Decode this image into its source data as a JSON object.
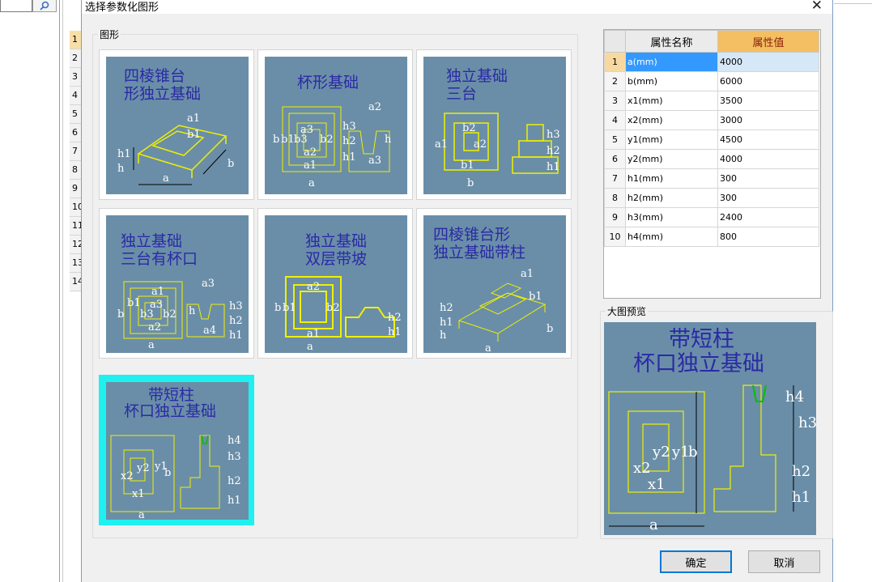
{
  "dialog": {
    "title": "选择参数化图形",
    "close_icon": "close-icon",
    "shape_group_label": "图形",
    "preview_group_label": "大图预览",
    "ok_label": "确定",
    "cancel_label": "取消"
  },
  "background": {
    "row_numbers": [
      "1",
      "2",
      "3",
      "4",
      "5",
      "6",
      "7",
      "8",
      "9",
      "10",
      "11",
      "12",
      "13",
      "14"
    ],
    "search_icon": "search-icon"
  },
  "shapes": [
    {
      "title1": "四棱锥台",
      "title2": "形独立基础",
      "labels": [
        "a1",
        "b1",
        "h1",
        "h",
        "a",
        "b"
      ]
    },
    {
      "title1": "杯形基础",
      "title2": "",
      "labels": [
        "b",
        "b1",
        "b3",
        "a3",
        "b2",
        "a2",
        "a1",
        "a",
        "h3",
        "h2",
        "h1",
        "h",
        "a2",
        "a3"
      ]
    },
    {
      "title1": "独立基础",
      "title2": "三台",
      "labels": [
        "a1",
        "b2",
        "a2",
        "b1",
        "b",
        "h3",
        "h2",
        "h1"
      ]
    },
    {
      "title1": "独立基础",
      "title2": "三台有杯口",
      "labels": [
        "a1",
        "b1",
        "a3",
        "b3",
        "b2",
        "a2",
        "b",
        "a",
        "a3",
        "h",
        "a4",
        "h3",
        "h2",
        "h1"
      ]
    },
    {
      "title1": "独立基础",
      "title2": "双层带坡",
      "labels": [
        "a2",
        "b1",
        "b",
        "b2",
        "a1",
        "a",
        "h2",
        "h1"
      ]
    },
    {
      "title1": "四棱锥台形",
      "title2": "独立基础带柱",
      "labels": [
        "a1",
        "b1",
        "h2",
        "h1",
        "h",
        "a",
        "b"
      ]
    },
    {
      "title1": "带短柱",
      "title2": "杯口独立基础",
      "labels": [
        "x2",
        "y2",
        "y1",
        "b",
        "x1",
        "a",
        "h4",
        "h3",
        "h2",
        "h1"
      ]
    }
  ],
  "selected_shape_index": 6,
  "properties": {
    "header_index": "",
    "header_name": "属性名称",
    "header_value": "属性值",
    "rows": [
      {
        "index": "1",
        "name": "a(mm)",
        "value": "4000"
      },
      {
        "index": "2",
        "name": "b(mm)",
        "value": "6000"
      },
      {
        "index": "3",
        "name": "x1(mm)",
        "value": "3500"
      },
      {
        "index": "4",
        "name": "x2(mm)",
        "value": "3000"
      },
      {
        "index": "5",
        "name": "y1(mm)",
        "value": "4500"
      },
      {
        "index": "6",
        "name": "y2(mm)",
        "value": "4000"
      },
      {
        "index": "7",
        "name": "h1(mm)",
        "value": "300"
      },
      {
        "index": "8",
        "name": "h2(mm)",
        "value": "300"
      },
      {
        "index": "9",
        "name": "h3(mm)",
        "value": "2400"
      },
      {
        "index": "10",
        "name": "h4(mm)",
        "value": "800"
      }
    ],
    "selected_row_index": 0
  },
  "preview": {
    "title1": "带短柱",
    "title2": "杯口独立基础",
    "labels": [
      "x2",
      "y2",
      "y1",
      "b",
      "x1",
      "a",
      "h4",
      "h3",
      "h2",
      "h1"
    ]
  },
  "colors": {
    "diagram_bg": "#6a8ea8",
    "diagram_title": "#2a2aa6",
    "diagram_lines": "#f0f000",
    "selected_thumb": "#1ff0f0",
    "header_value_bg": "#f4bf62",
    "selected_row": "#3399ff"
  }
}
